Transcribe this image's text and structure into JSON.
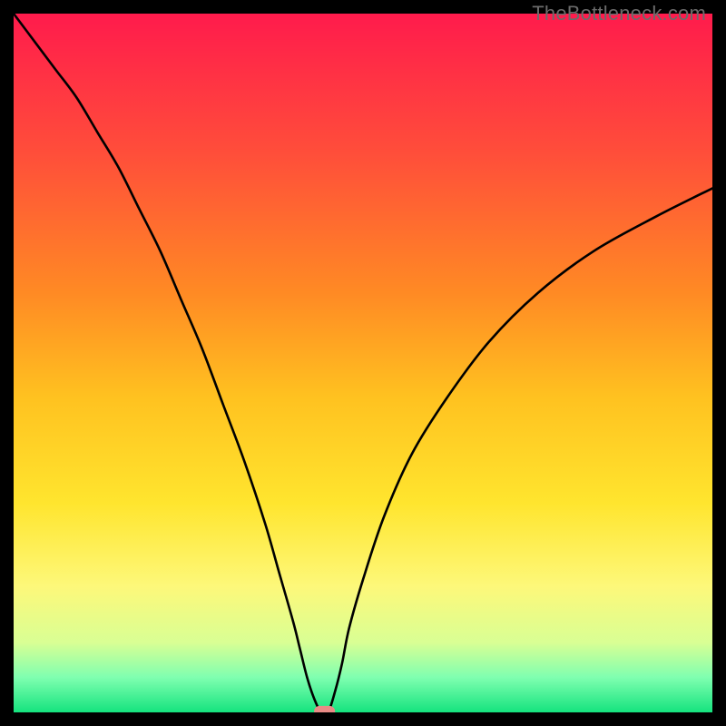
{
  "watermark": {
    "text": "TheBottleneck.com"
  },
  "chart_data": {
    "type": "line",
    "title": "",
    "xlabel": "",
    "ylabel": "",
    "xlim": [
      0,
      100
    ],
    "ylim": [
      0,
      100
    ],
    "grid": false,
    "legend": false,
    "background_gradient_stops": [
      {
        "offset": 0.0,
        "color": "#ff1b4c"
      },
      {
        "offset": 0.2,
        "color": "#ff4e3a"
      },
      {
        "offset": 0.4,
        "color": "#ff8a24"
      },
      {
        "offset": 0.55,
        "color": "#ffc220"
      },
      {
        "offset": 0.7,
        "color": "#ffe52e"
      },
      {
        "offset": 0.82,
        "color": "#fdf87a"
      },
      {
        "offset": 0.9,
        "color": "#d9ff94"
      },
      {
        "offset": 0.95,
        "color": "#7fffb0"
      },
      {
        "offset": 1.0,
        "color": "#15e37e"
      }
    ],
    "series": [
      {
        "name": "bottleneck-curve",
        "x": [
          0,
          3,
          6,
          9,
          12,
          15,
          18,
          21,
          24,
          27,
          30,
          33,
          36,
          38,
          40,
          41,
          42,
          43,
          44,
          45,
          46,
          47,
          48,
          50,
          53,
          57,
          62,
          68,
          75,
          83,
          92,
          100
        ],
        "y": [
          100,
          96,
          92,
          88,
          83,
          78,
          72,
          66,
          59,
          52,
          44,
          36,
          27,
          20,
          13,
          9,
          5,
          2,
          0,
          0,
          3,
          7,
          12,
          19,
          28,
          37,
          45,
          53,
          60,
          66,
          71,
          75
        ]
      }
    ],
    "marker": {
      "name": "optimal-point",
      "x": 44.5,
      "y": 0,
      "shape": "rounded-pill",
      "width_pct": 3.0,
      "height_pct": 1.6,
      "color": "#e98b86"
    }
  }
}
